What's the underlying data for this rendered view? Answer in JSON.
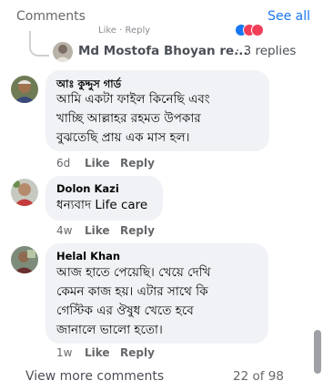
{
  "header": {
    "title": "Comments",
    "see_all": "See all"
  },
  "cut_row": {
    "text": "Like · Reply"
  },
  "reply_preview": {
    "author": "Md Mostofa Bhoyan re...",
    "count": "· 3 replies"
  },
  "comments": [
    {
      "author": "আঃ কুদ্দুস গার্ড",
      "text": "আমি একটা ফাইল কিনেছি এবং\nখাচ্ছি আল্লাহর রহমত উপকার\nবুঝতেছি প্রায় এক মাস হল।",
      "time": "6d",
      "like": "Like",
      "reply": "Reply"
    },
    {
      "author": "Dolon Kazi",
      "text": "ধন্যবাদ Life care",
      "time": "4w",
      "like": "Like",
      "reply": "Reply"
    },
    {
      "author": "Helal Khan",
      "text": "আজ হাতে পেয়েছি। খেয়ে দেখি\nকেমন কাজ হয়। এটার সাথে কি\nগেস্টিক এর ঔষুধ খেতে হবে\nজানালে ভালো হতো।",
      "time": "1w",
      "like": "Like",
      "reply": "Reply"
    }
  ],
  "footer": {
    "view_more": "View more comments",
    "pagination": "22 of 98"
  },
  "colors": {
    "link": "#1877f2",
    "bubble": "#f0f2f5",
    "meta": "#65676b"
  }
}
